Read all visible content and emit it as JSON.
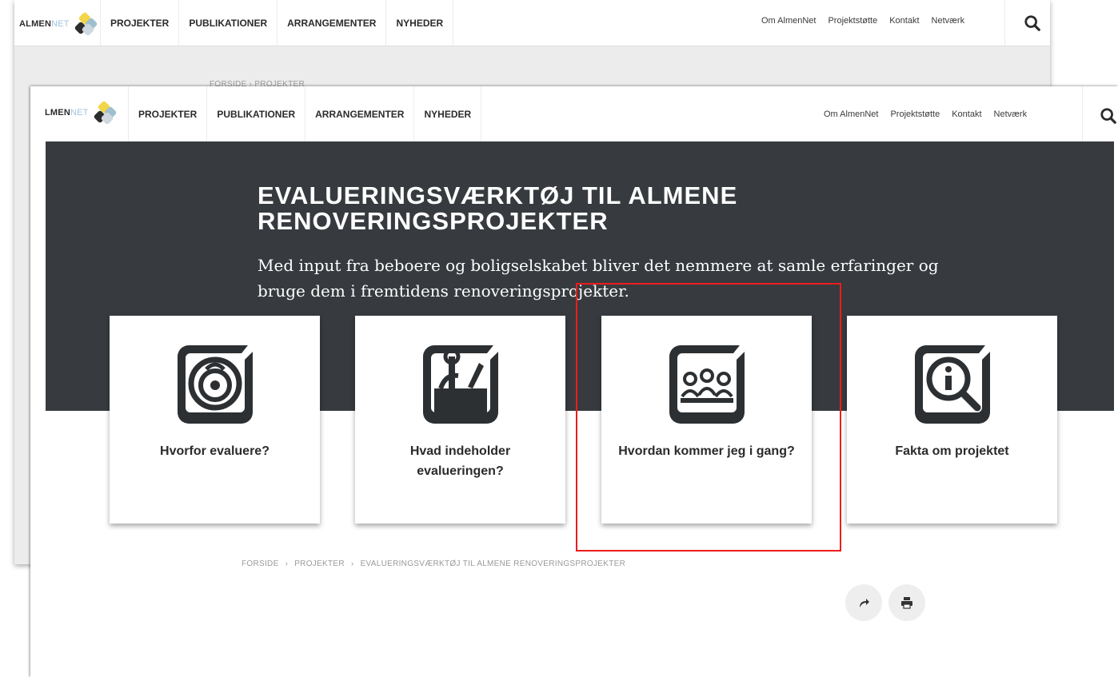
{
  "logo": {
    "brand_main": "ALMEN",
    "brand_accent": "NET",
    "front_brand_main": "LMEN"
  },
  "nav": {
    "menu": [
      "PROJEKTER",
      "PUBLIKATIONER",
      "ARRANGEMENTER",
      "NYHEDER"
    ],
    "utility": [
      "Om AlmenNet",
      "Projektstøtte",
      "Kontakt",
      "Netværk"
    ],
    "search_icon": "search-icon"
  },
  "back_window": {
    "breadcrumb": "FORSIDE  ›  PROJEKTER"
  },
  "hero": {
    "title": "EVALUERINGSVÆRKTØJ TIL ALMENE RENOVERINGSPROJEKTER",
    "subtitle": "Med input fra beboere og boligselskabet bliver det nemmere at samle erfaringer og bruge dem i fremtidens renoveringsprojekter."
  },
  "cards": [
    {
      "label": "Hvorfor evaluere?",
      "icon": "target-question-icon"
    },
    {
      "label": "Hvad indeholder evalueringen?",
      "icon": "toolbox-icon"
    },
    {
      "label": "Hvordan kommer jeg i gang?",
      "icon": "people-group-icon"
    },
    {
      "label": "Fakta om projektet",
      "icon": "info-magnifier-icon"
    }
  ],
  "breadcrumb": [
    "FORSIDE",
    "PROJEKTER",
    "EVALUERINGSVÆRKTØJ TIL ALMENE RENOVERINGSPROJEKTER"
  ],
  "breadcrumb_sep": "›",
  "actions": {
    "share_icon": "share-icon",
    "print_icon": "print-icon"
  },
  "colors": {
    "hero_bg": "#373b3f",
    "highlight": "#ee1c1c",
    "logo_yellow": "#f2d64a",
    "logo_blue": "#9fbfd1"
  }
}
